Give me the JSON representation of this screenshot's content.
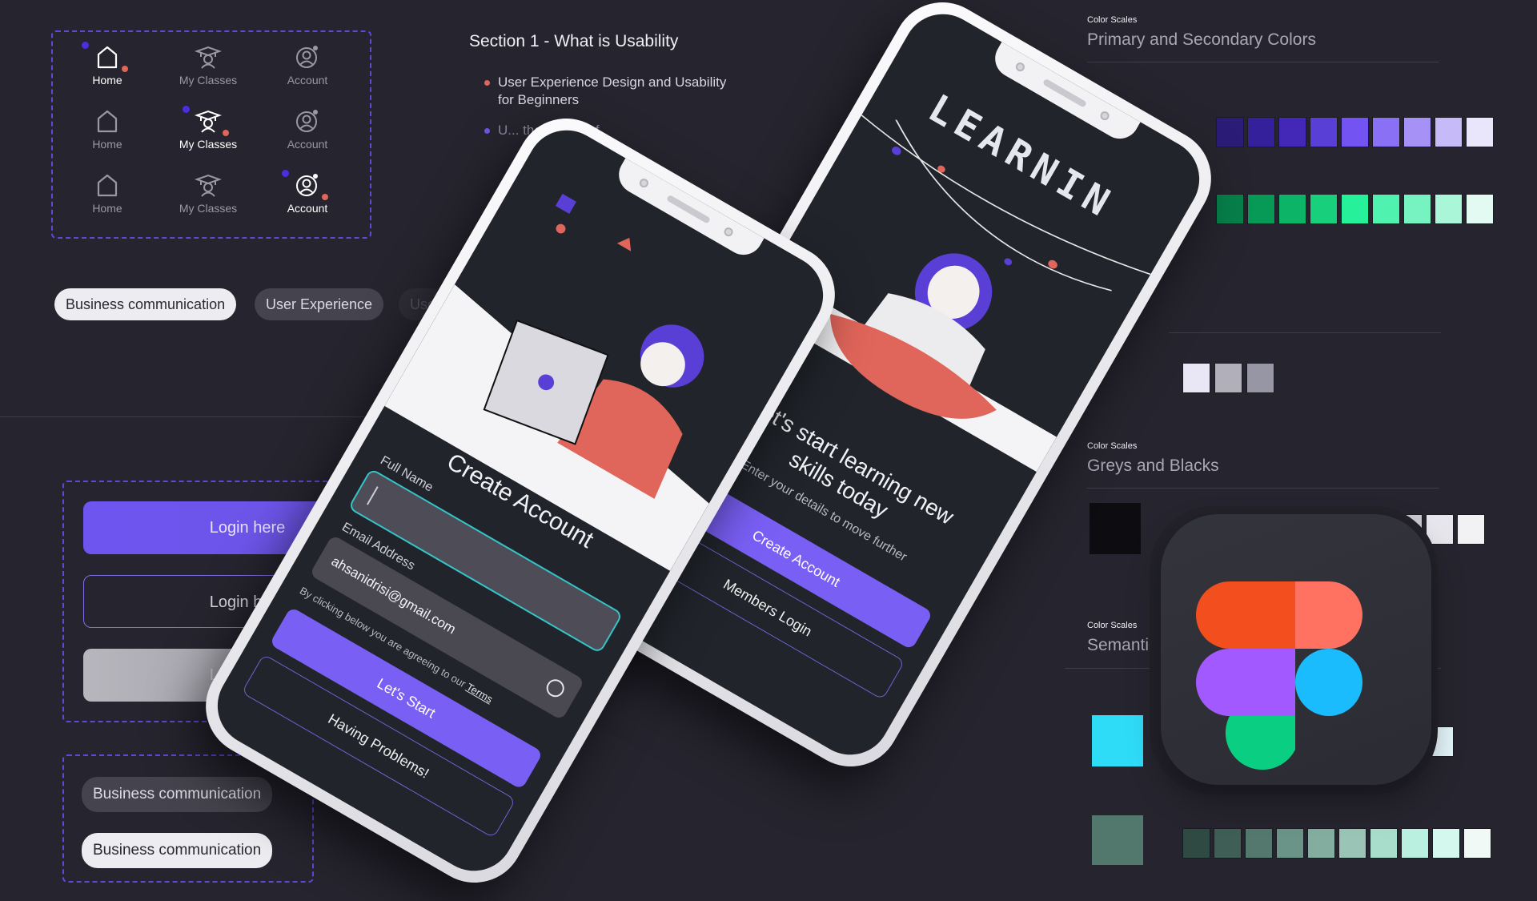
{
  "nav_variants": {
    "rows": [
      {
        "active": "home",
        "items": [
          {
            "id": "home",
            "label": "Home",
            "icon": "home-icon"
          },
          {
            "id": "classes",
            "label": "My Classes",
            "icon": "graduation-cap-icon"
          },
          {
            "id": "account",
            "label": "Account",
            "icon": "account-settings-icon"
          }
        ]
      },
      {
        "active": "classes",
        "items": [
          {
            "id": "home",
            "label": "Home",
            "icon": "home-icon"
          },
          {
            "id": "classes",
            "label": "My Classes",
            "icon": "graduation-cap-icon"
          },
          {
            "id": "account",
            "label": "Account",
            "icon": "account-settings-icon"
          }
        ]
      },
      {
        "active": "account",
        "items": [
          {
            "id": "home",
            "label": "Home",
            "icon": "home-icon"
          },
          {
            "id": "classes",
            "label": "My Classes",
            "icon": "graduation-cap-icon"
          },
          {
            "id": "account",
            "label": "Account",
            "icon": "account-settings-icon"
          }
        ]
      }
    ]
  },
  "section": {
    "title": "Section 1 - What is Usability",
    "bullets": [
      {
        "text": "User Experience Design and Usability for Beginners",
        "color": "#e0655a"
      },
      {
        "text": "U... the basics of",
        "color": "#6a55e8"
      }
    ]
  },
  "chips_row": [
    "Business communication",
    "User Experience",
    "Use"
  ],
  "buttons": {
    "primary": "Login here",
    "outline": "Login here",
    "disabled": "Login here"
  },
  "chip_variants": [
    "Business communication",
    "Business communication"
  ],
  "color_scales": [
    {
      "label": "Color Scales",
      "title": "Primary and Secondary Colors",
      "rows": [
        [
          "#2b1c78",
          "#34209a",
          "#4328b8",
          "#5a3fd6",
          "#7353f2",
          "#8a70f4",
          "#a692f6",
          "#c7baf8",
          "#e9e5fb"
        ],
        [
          "#07804a",
          "#079a57",
          "#0cb467",
          "#18d07c",
          "#26f09a",
          "#4ff2ae",
          "#76f3c0",
          "#aaf6d9",
          "#e2faf1"
        ]
      ],
      "neutrals": [
        "#e9e6f6",
        "#b0afba",
        "#9796a4"
      ]
    },
    {
      "label": "Color Scales",
      "title": "Greys and Blacks",
      "base": "#0d0c10",
      "row": [
        "#c9c8cf",
        "#e6e6ec",
        "#f2f2f5"
      ]
    },
    {
      "label": "Color Scales",
      "title": "Semantic",
      "bases": [
        "#2fdcf8",
        "#52786d"
      ],
      "rows": [
        [
          "#9fd0de",
          "#e4f6fb"
        ],
        [
          "#2e4a43",
          "#3f5f56",
          "#54786d",
          "#6a9487",
          "#83ae9f",
          "#9ac5b6",
          "#a8dccb",
          "#b9f0df",
          "#d5f8ee",
          "#f0f9f6"
        ]
      ]
    }
  ],
  "phone_left": {
    "title": "Create Account",
    "full_name_label": "Full Name",
    "full_name_value": "",
    "email_label": "Email Address",
    "email_value": "ahsanidrisi@gmail.com",
    "terms_text": "By clicking below you are agreeing to our",
    "terms_link": "Terms",
    "primary_button": "Let's Start",
    "secondary_button": "Having Problems!"
  },
  "phone_right": {
    "brand": "LEARNIN",
    "headline": "Let's start learning new skills today",
    "subtitle": "Enter your details to move further",
    "primary_button": "Create Account",
    "secondary_button": "Members Login"
  },
  "colors": {
    "accent": "#7a5ff5",
    "danger": "#e0655a",
    "background": "#26242e"
  }
}
